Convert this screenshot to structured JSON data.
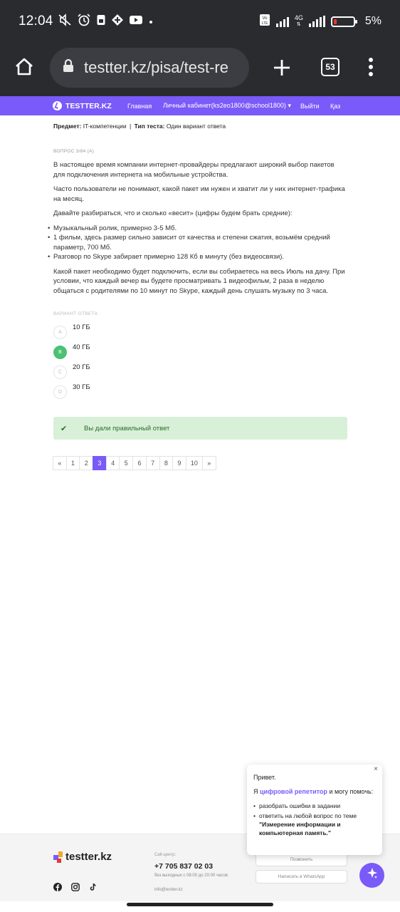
{
  "status_bar": {
    "time": "12:04",
    "net_type": "4G",
    "battery": "5%",
    "icons": [
      "mute-icon",
      "alarm-icon",
      "sim-icon",
      "app-icon",
      "youtube-icon",
      "dot-icon",
      "volte-icon",
      "signal-icon",
      "battery-icon"
    ]
  },
  "browser": {
    "url": "testter.kz/pisa/test-re",
    "tab_count": "53"
  },
  "site_nav": {
    "logo": "TESTTER.KZ",
    "links": [
      "Главная",
      "Личный кабинет(ks2eo1800@school1800)",
      "Выйти",
      "Қаз"
    ]
  },
  "meta": {
    "subject_label": "Предмет:",
    "subject": "IT-компетенции",
    "type_label": "Тип теста:",
    "type": "Один вариант ответа"
  },
  "question": {
    "label": "ВОПРОС 3/84 (А)",
    "paragraphs": [
      "В настоящее время компании интернет-провайдеры предлагают широкий выбор пакетов для подключения интернета на мобильные устройства.",
      "Часто пользователи не понимают, какой пакет им нужен и хватит ли у них интернет-трафика на месяц.",
      "Давайте разбираться, что и сколько «весит» (цифры будем брать средние):"
    ],
    "bullets": [
      "Музыкальный ролик, примерно 3-5 Мб.",
      "1 фильм, здесь размер сильно зависит от качества и степени сжатия, возьмём средний параметр, 700 Мб.",
      "Разговор по Skype забирает примерно 128 Кб в минуту (без видеосвязи)."
    ],
    "final": "Какой пакет необходимо будет подключить, если вы собираетесь на весь Июль на дачу. При условии, что каждый вечер вы будете просматривать 1 видеофильм, 2 раза в неделю общаться с родителями по 10 минут по Skype, каждый день слушать музыку по 3 часа."
  },
  "answers": {
    "label": "ВАРИАНТ ОТВЕТА",
    "options": [
      {
        "letter": "A",
        "text": "10 ГБ"
      },
      {
        "letter": "B",
        "text": "40 ГБ"
      },
      {
        "letter": "C",
        "text": "20 ГБ"
      },
      {
        "letter": "D",
        "text": "30 ГБ"
      }
    ]
  },
  "result": {
    "text": "Вы дали правильный ответ"
  },
  "pagination": [
    "«",
    "1",
    "2",
    "3",
    "4",
    "5",
    "6",
    "7",
    "8",
    "9",
    "10",
    "»"
  ],
  "footer": {
    "logo": "testter.kz",
    "call_label": "Call-центр:",
    "phone": "+7 705 837 02 03",
    "hours": "без выходных с 08:00 до 20:00 часов",
    "email": "info@testter.kz",
    "call_button": "Позвонить",
    "whatsapp_button": "Написать в WhatsApp"
  },
  "chat": {
    "greeting": "Привет.",
    "intro_1": "Я ",
    "intro_hl": "цифровой репетитор",
    "intro_2": " и могу помочь:",
    "item_1": "разобрать ошибки в задании",
    "item_2_prefix": "ответить на любой вопрос по теме ",
    "item_2_topic": "\"Измерение информации и компьютерная память.\""
  }
}
